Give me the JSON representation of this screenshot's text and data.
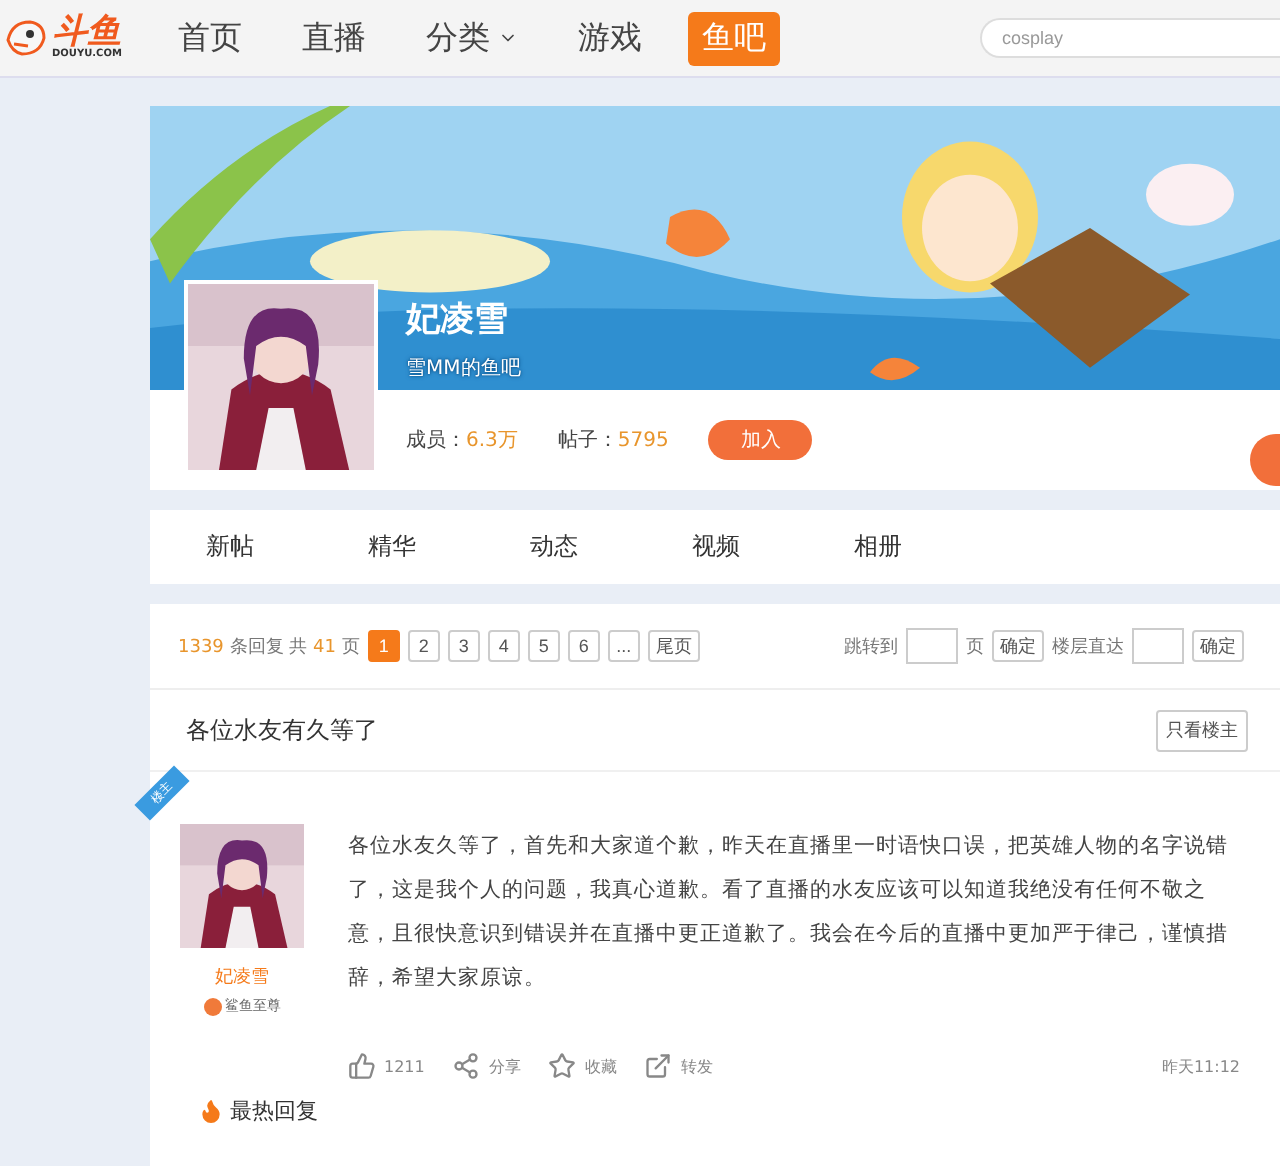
{
  "header": {
    "logo": {
      "mark": "斗鱼",
      "domain": "DOUYU.COM"
    },
    "nav": [
      {
        "label": "首页",
        "selected": false,
        "dropdown": false
      },
      {
        "label": "直播",
        "selected": false,
        "dropdown": false
      },
      {
        "label": "分类",
        "selected": false,
        "dropdown": true
      },
      {
        "label": "游戏",
        "selected": false,
        "dropdown": false
      },
      {
        "label": "鱼吧",
        "selected": true,
        "dropdown": false
      }
    ],
    "search": {
      "placeholder": "cosplay"
    }
  },
  "group": {
    "name": "妃凌雪",
    "subtitle": "雪MM的鱼吧",
    "stats": [
      {
        "label": "成员：",
        "value": "6.3万"
      },
      {
        "label": "帖子：",
        "value": "5795"
      }
    ],
    "join": "加入"
  },
  "tabs": [
    "新帖",
    "精华",
    "动态",
    "视频",
    "相册"
  ],
  "pagination": {
    "replies": "1339",
    "replies_label": "条回复 共",
    "pages": "41",
    "pages_label": "页",
    "pages_list": [
      {
        "label": "1",
        "selected": true
      },
      {
        "label": "2",
        "selected": false
      },
      {
        "label": "3",
        "selected": false
      },
      {
        "label": "4",
        "selected": false
      },
      {
        "label": "5",
        "selected": false
      },
      {
        "label": "6",
        "selected": false
      },
      {
        "label": "...",
        "selected": false
      },
      {
        "label": "尾页",
        "selected": false
      }
    ],
    "jump_label": "跳转到",
    "jump_unit": "页",
    "confirm": "确定",
    "floor_label": "楼层直达",
    "floor_confirm": "确定"
  },
  "post": {
    "title": "各位水友有久等了",
    "only_author": "只看楼主",
    "badge": "楼主",
    "author": "妃凌雪",
    "rank": "鲨鱼至尊",
    "body": "各位水友久等了，首先和大家道个歉，昨天在直播里一时语快口误，把英雄人物的名字说错了，这是我个人的问题，我真心道歉。看了直播的水友应该可以知道我绝没有任何不敬之意，且很快意识到错误并在直播中更正道歉了。我会在今后的直播中更加严于律己，谨慎措辞，希望大家原谅。",
    "actions": [
      {
        "kind": "like",
        "label": "1211"
      },
      {
        "kind": "share",
        "label": "分享"
      },
      {
        "kind": "favorite",
        "label": "收藏"
      },
      {
        "kind": "forward",
        "label": "转发"
      }
    ],
    "time": "昨天11:12"
  },
  "hot_replies": "最热回复"
}
